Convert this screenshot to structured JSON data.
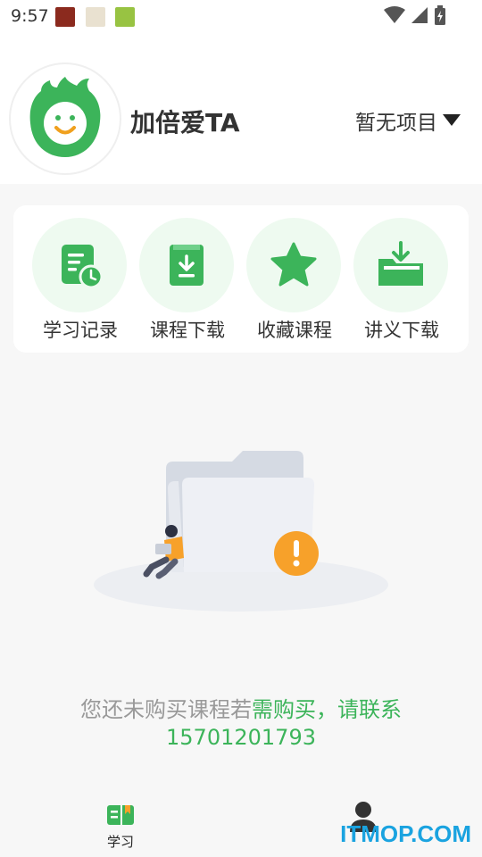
{
  "status_bar": {
    "time": "9:57",
    "icons": [
      "app-notification-icon",
      "app-notification-icon",
      "app-notification-icon",
      "wifi-icon",
      "signal-icon",
      "battery-charging-icon"
    ]
  },
  "profile": {
    "name": "加倍爱TA",
    "project_select": "暂无项目",
    "avatar_icon": "smiley-flame-icon"
  },
  "menu": [
    {
      "label": "学习记录",
      "icon": "study-record-icon"
    },
    {
      "label": "课程下载",
      "icon": "course-download-icon"
    },
    {
      "label": "收藏课程",
      "icon": "star-icon"
    },
    {
      "label": "讲义下载",
      "icon": "handout-download-icon"
    }
  ],
  "empty_state": {
    "text_gray": "您还未购买课程若",
    "text_green": "需购买，请联系",
    "phone": "15701201793"
  },
  "bottom_nav": {
    "study_label": "学习",
    "mine_label": "我的"
  },
  "watermark": "ITMOP.COM",
  "colors": {
    "primary_green": "#3cb45a",
    "menu_circle_bg": "#eefaf0",
    "warning_orange": "#f7a12a"
  }
}
